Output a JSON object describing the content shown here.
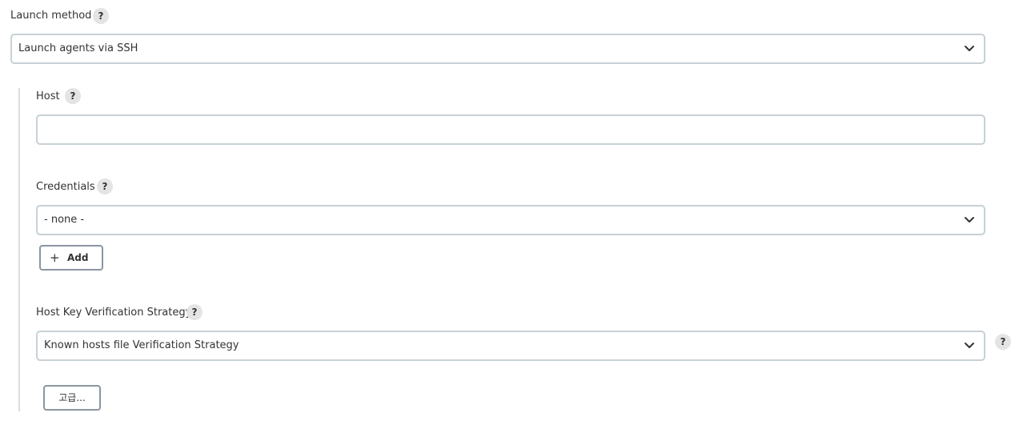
{
  "launch_method": {
    "label": "Launch method",
    "help": "?",
    "selected": "Launch agents via SSH"
  },
  "host": {
    "label": "Host",
    "help": "?",
    "value": ""
  },
  "credentials": {
    "label": "Credentials",
    "help": "?",
    "selected": "- none -",
    "add_button": {
      "icon": "+",
      "label": "Add"
    }
  },
  "host_key": {
    "label": "Host Key Verification Strategy",
    "help": "?",
    "selected": "Known hosts file Verification Strategy",
    "side_help": "?"
  },
  "advanced_button": {
    "label": "고급..."
  }
}
